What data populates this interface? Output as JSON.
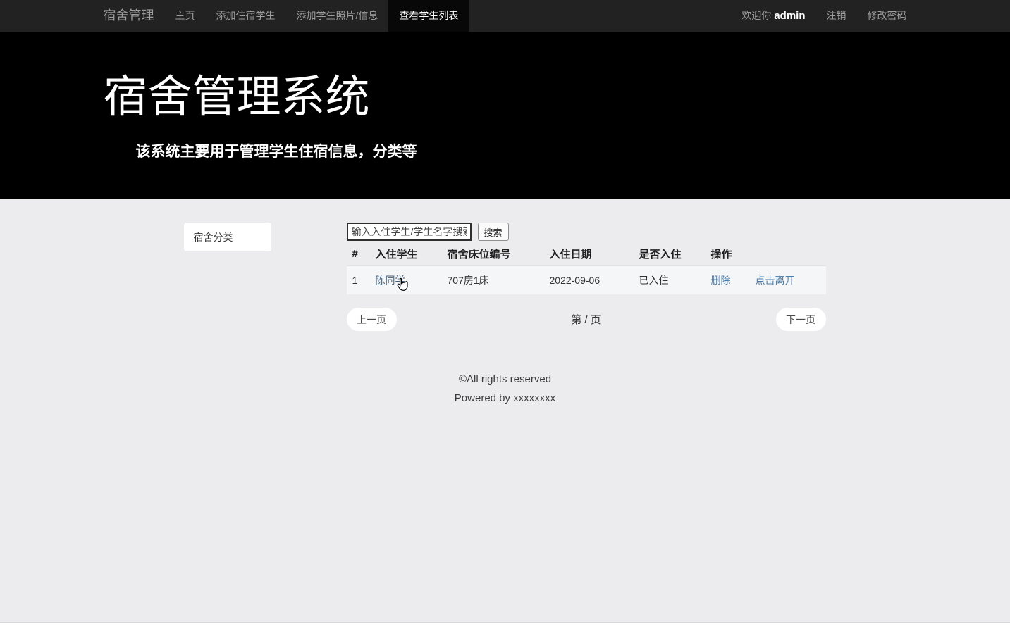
{
  "nav": {
    "brand": "宿舍管理",
    "items": [
      {
        "label": "主页",
        "active": false
      },
      {
        "label": "添加住宿学生",
        "active": false
      },
      {
        "label": "添加学生照片/信息",
        "active": false
      },
      {
        "label": "查看学生列表",
        "active": true
      }
    ],
    "welcome_prefix": "欢迎你",
    "username": "admin",
    "logout_label": "注销",
    "change_password_label": "修改密码"
  },
  "hero": {
    "title": "宿舍管理系统",
    "subtitle": "该系统主要用于管理学生住宿信息，分类等"
  },
  "sidebar": {
    "category_label": "宿舍分类"
  },
  "search": {
    "placeholder": "输入入住学生/学生名字搜索",
    "button_label": "搜索"
  },
  "table": {
    "headers": [
      "#",
      "入住学生",
      "宿舍床位编号",
      "入住日期",
      "是否入住",
      "操作",
      ""
    ],
    "rows": [
      {
        "index": "1",
        "student": "陈同学",
        "bed": "707房1床",
        "date": "2022-09-06",
        "status": "已入住",
        "delete_label": "删除",
        "leave_label": "点击离开"
      }
    ]
  },
  "pagination": {
    "prev_label": "上一页",
    "page_info": "第 / 页",
    "next_label": "下一页"
  },
  "footer": {
    "copyright": "©All rights reserved",
    "powered_by": "Powered by xxxxxxxx"
  },
  "colors": {
    "navbar_bg": "#222222",
    "navbar_active_bg": "#080808",
    "navbar_text": "#9d9d9d",
    "hero_bg": "#000000",
    "page_bg": "#ececee",
    "row_bg": "#f5f6f7",
    "action_link": "#4d7ca8",
    "student_link": "#3f5c77"
  }
}
